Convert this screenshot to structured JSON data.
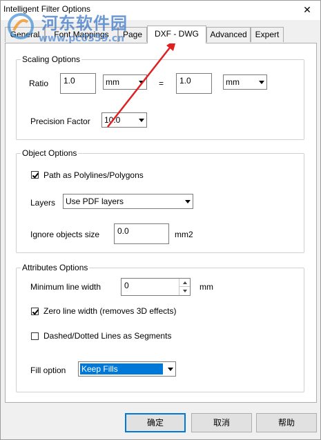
{
  "window": {
    "title": "Intelligent Filter Options",
    "close_symbol": "✕"
  },
  "watermark": {
    "line1": "河东软件园",
    "line2": "www.pc0359.cn"
  },
  "tabs": [
    {
      "label": "General"
    },
    {
      "label": "Font Mappings"
    },
    {
      "label": "Page"
    },
    {
      "label": "DXF - DWG",
      "active": true
    },
    {
      "label": "Advanced"
    },
    {
      "label": "Expert"
    }
  ],
  "scaling": {
    "title": "Scaling Options",
    "ratio_label": "Ratio",
    "ratio_left_value": "1.0",
    "ratio_left_unit": "mm",
    "equals": "=",
    "ratio_right_value": "1.0",
    "ratio_right_unit": "mm",
    "precision_label": "Precision Factor",
    "precision_value": "10.0"
  },
  "object": {
    "title": "Object Options",
    "path_checkbox_label": "Path as Polylines/Polygons",
    "path_checked": true,
    "layers_label": "Layers",
    "layers_value": "Use PDF layers",
    "ignore_label": "Ignore objects size",
    "ignore_value": "0.0",
    "ignore_unit": "mm2"
  },
  "attributes": {
    "title": "Attributes Options",
    "min_width_label": "Minimum line width",
    "min_width_value": "0",
    "min_width_unit": "mm",
    "zero_width_label": "Zero line width (removes 3D effects)",
    "zero_width_checked": true,
    "dashed_label": "Dashed/Dotted Lines as Segments",
    "dashed_checked": false,
    "fill_label": "Fill option",
    "fill_value": "Keep Fills"
  },
  "buttons": {
    "ok": "确定",
    "cancel": "取消",
    "help": "帮助"
  },
  "colors": {
    "accent": "#0078d7",
    "annotation_arrow": "#e02020"
  }
}
